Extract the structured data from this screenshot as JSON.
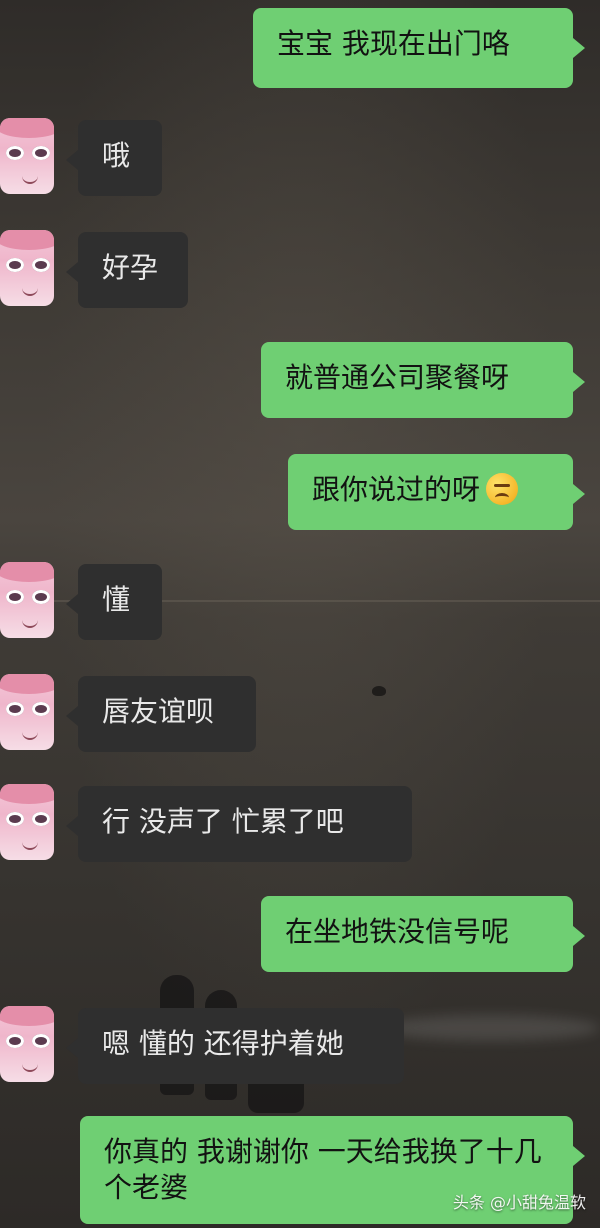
{
  "messages": [
    {
      "side": "out",
      "text": "宝宝 我现在出门咯"
    },
    {
      "side": "in",
      "text": "哦"
    },
    {
      "side": "in",
      "text": "好孕"
    },
    {
      "side": "out",
      "text": "就普通公司聚餐呀"
    },
    {
      "side": "out",
      "text": "跟你说过的呀",
      "emoji": "worried-face-emoji"
    },
    {
      "side": "in",
      "text": "懂"
    },
    {
      "side": "in",
      "text": "唇友谊呗"
    },
    {
      "side": "in",
      "text": "行 没声了 忙累了吧"
    },
    {
      "side": "out",
      "text": "在坐地铁没信号呢"
    },
    {
      "side": "in",
      "text": "嗯 懂的 还得护着她"
    },
    {
      "side": "out",
      "text": "你真的 我谢谢你 一天给我换了十几个老婆"
    }
  ],
  "watermark": "头条 @小甜兔温软",
  "colors": {
    "outgoing_bubble": "#6fcf73",
    "incoming_bubble": "#2f2f2f"
  }
}
